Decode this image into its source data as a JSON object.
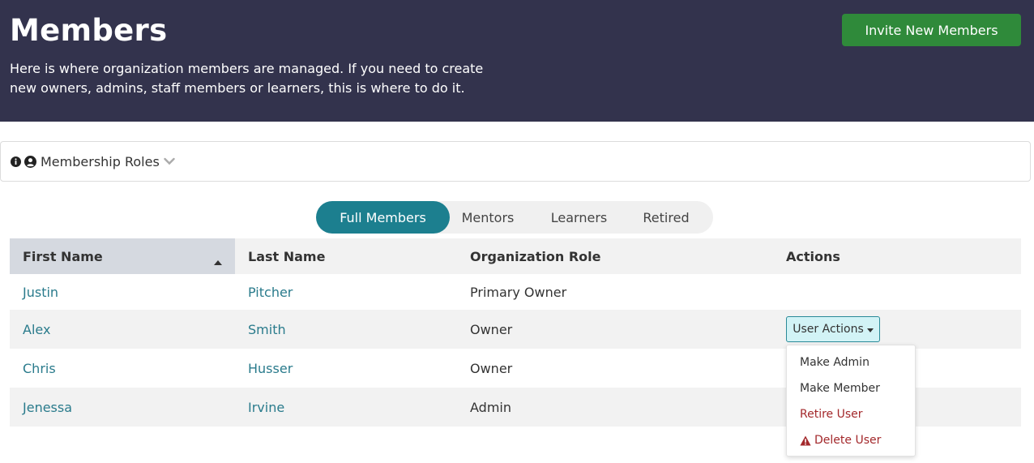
{
  "header": {
    "title": "Members",
    "description": "Here is where organization members are managed. If you need to create new owners, admins, staff members or learners, this is where to do it.",
    "invite_label": "Invite New Members"
  },
  "roles_bar": {
    "label": "Membership Roles",
    "icons": [
      "info-icon",
      "user-circle-icon",
      "chevron-down-icon"
    ]
  },
  "tabs": [
    {
      "label": "Full Members",
      "active": true
    },
    {
      "label": "Mentors",
      "active": false
    },
    {
      "label": "Learners",
      "active": false
    },
    {
      "label": "Retired",
      "active": false
    }
  ],
  "table": {
    "columns": [
      "First Name",
      "Last Name",
      "Organization Role",
      "Actions"
    ],
    "sort": {
      "column": "First Name",
      "direction": "ascending"
    },
    "rows": [
      {
        "first": "Justin",
        "last": "Pitcher",
        "role": "Primary Owner"
      },
      {
        "first": "Alex",
        "last": "Smith",
        "role": "Owner",
        "action_label": "User Actions"
      },
      {
        "first": "Chris",
        "last": "Husser",
        "role": "Owner"
      },
      {
        "first": "Jenessa",
        "last": "Irvine",
        "role": "Admin"
      }
    ]
  },
  "user_actions_menu": {
    "items": [
      "Make Admin",
      "Make Member",
      "Retire User",
      "Delete User"
    ]
  },
  "colors": {
    "header_bg": "#33334d",
    "invite_green": "#2f8a3a",
    "tab_active": "#1c7f8f",
    "link": "#2a7b8c",
    "danger": "#a3282b"
  }
}
